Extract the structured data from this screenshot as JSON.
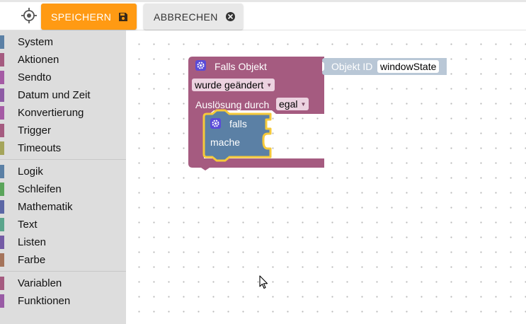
{
  "toolbar": {
    "save_label": "SPEICHERN",
    "cancel_label": "ABBRECHEN"
  },
  "sidebar": {
    "groups": [
      [
        {
          "label": "System",
          "color": "#5b80a5"
        },
        {
          "label": "Aktionen",
          "color": "#a55b80"
        },
        {
          "label": "Sendto",
          "color": "#a55ba5"
        },
        {
          "label": "Datum und Zeit",
          "color": "#8e5ba5"
        },
        {
          "label": "Konvertierung",
          "color": "#a55ba5"
        },
        {
          "label": "Trigger",
          "color": "#a55b80"
        },
        {
          "label": "Timeouts",
          "color": "#a5a55b"
        }
      ],
      [
        {
          "label": "Logik",
          "color": "#5b80a5"
        },
        {
          "label": "Schleifen",
          "color": "#5ba55b"
        },
        {
          "label": "Mathematik",
          "color": "#5b67a5"
        },
        {
          "label": "Text",
          "color": "#5ba58c"
        },
        {
          "label": "Listen",
          "color": "#745ba5"
        },
        {
          "label": "Farbe",
          "color": "#a5745b"
        }
      ],
      [
        {
          "label": "Variablen",
          "color": "#a55b80"
        },
        {
          "label": "Funktionen",
          "color": "#995ba5"
        }
      ]
    ]
  },
  "workspace": {
    "trigger_block": {
      "title": "Falls Objekt",
      "event_field": "wurde geändert",
      "ack_label": "Auslösung durch",
      "ack_field": "egal",
      "color": "#a55b80"
    },
    "object_block": {
      "label": "Objekt ID",
      "value": "windowState",
      "color": "#b9c7d6"
    },
    "if_block": {
      "if_label": "falls",
      "do_label": "mache",
      "color": "#5b80a5",
      "highlight": "#f5c93a"
    }
  }
}
